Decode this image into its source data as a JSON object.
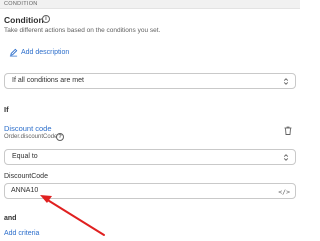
{
  "header": {
    "label": "CONDITION"
  },
  "section": {
    "title": "Condition",
    "description": "Take different actions based on the conditions you set.",
    "add_description_label": "Add description"
  },
  "match_select": {
    "value": "If all conditions are met"
  },
  "if_label": "If",
  "condition": {
    "title": "Discount code",
    "path": "Order.discountCode",
    "operator": "Equal to",
    "field_label": "DiscountCode",
    "value": "ANNA10"
  },
  "and_label": "and",
  "add_criteria_label": "Add criteria",
  "icons": {
    "info": "info-icon",
    "edit": "pen-icon",
    "help": "question-icon",
    "delete": "trash-icon",
    "code": "code-icon",
    "chevron": "select-chevron-icon"
  },
  "colors": {
    "link": "#2c6ecb",
    "annotation_arrow": "#e02020"
  }
}
